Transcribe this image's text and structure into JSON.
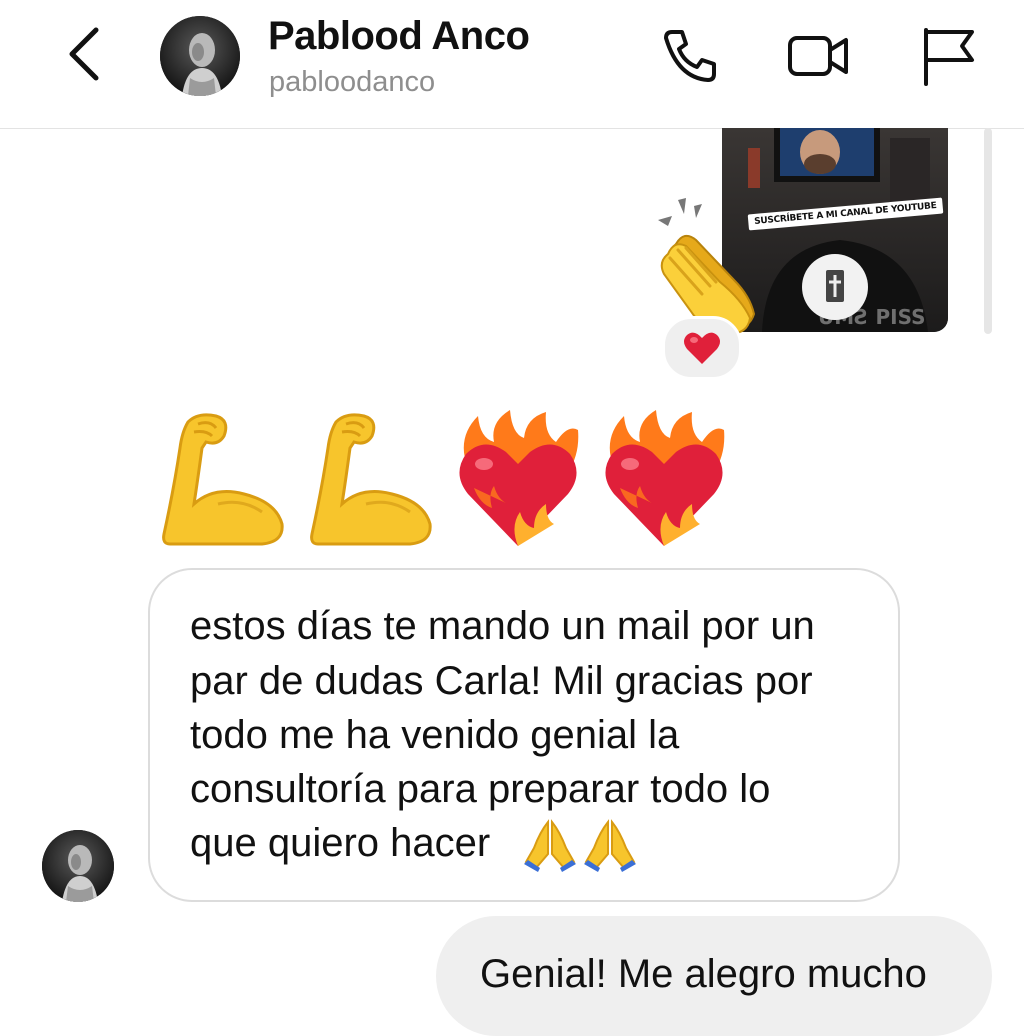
{
  "header": {
    "contact_name": "Pablood Anco",
    "contact_username": "pabloodanco",
    "back_icon": "chevron-left-icon",
    "call_icon": "phone-icon",
    "video_icon": "video-camera-icon",
    "report_icon": "flag-icon"
  },
  "shared_story": {
    "caption": "SUSCRÍBETE A MI CANAL DE YOUTUBE",
    "sticker": "clapping-hands-emoji",
    "reaction": "red-heart-emoji"
  },
  "emoji_message": [
    "flexed-biceps-emoji",
    "flexed-biceps-emoji",
    "heart-on-fire-emoji",
    "heart-on-fire-emoji"
  ],
  "received_message": {
    "lines": [
      "estos días te mando un mail por un",
      "par de dudas Carla! Mil gracias por",
      "todo me ha venido genial la",
      "consultoría para preparar todo lo",
      "que quiero hacer"
    ],
    "trailing_emoji": [
      "folded-hands-emoji",
      "folded-hands-emoji"
    ]
  },
  "sent_message": {
    "text": "Genial! Me alegro mucho"
  },
  "colors": {
    "background": "#ffffff",
    "received_bubble_border": "#dcdcdc",
    "sent_bubble_fill": "#efefef",
    "username_gray": "#8e8e8e",
    "heart_red": "#e0203a",
    "emoji_yellow": "#f7c52c"
  }
}
